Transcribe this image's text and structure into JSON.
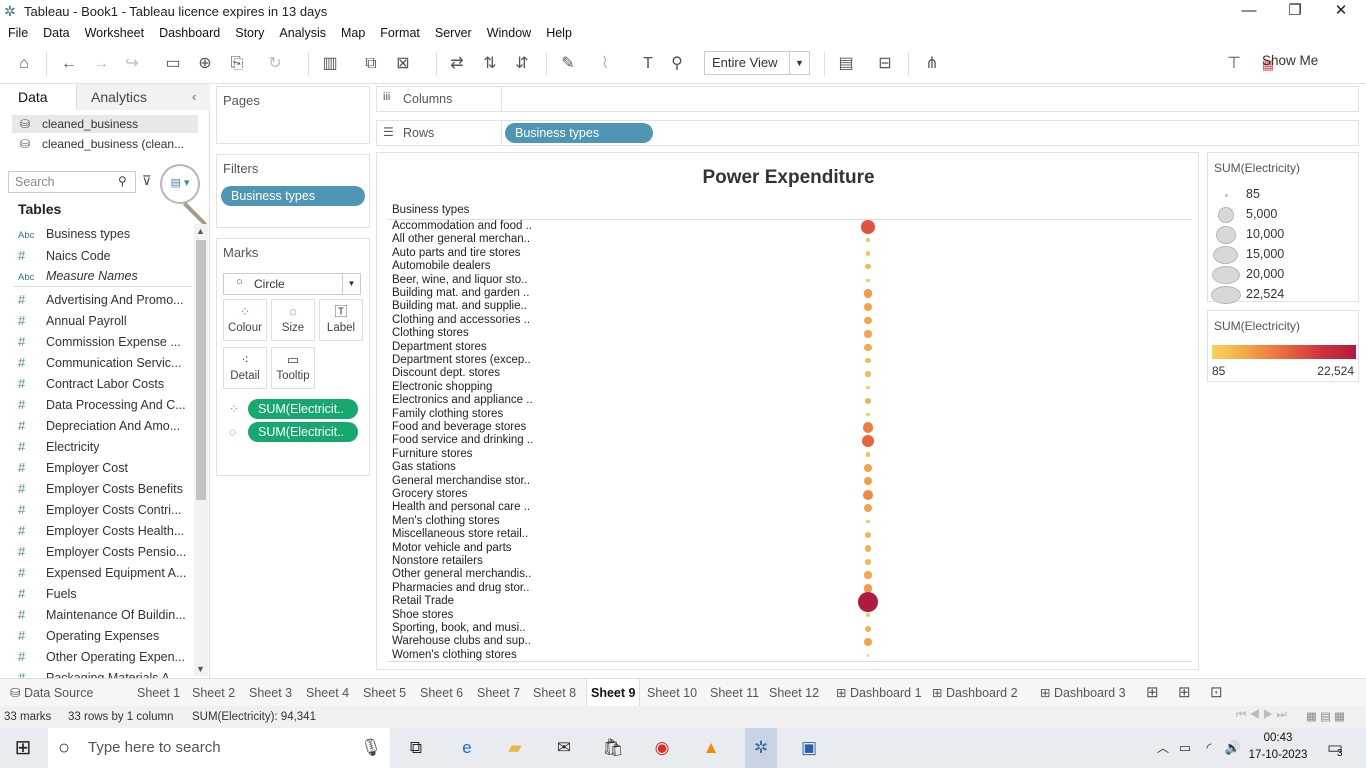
{
  "window": {
    "title": "Tableau - Book1 - Tableau licence expires in 13 days"
  },
  "menu": [
    "File",
    "Data",
    "Worksheet",
    "Dashboard",
    "Story",
    "Analysis",
    "Map",
    "Format",
    "Server",
    "Window",
    "Help"
  ],
  "toolbar": {
    "view_select": "Entire View",
    "show_me": "Show Me"
  },
  "left_pane": {
    "tab_data": "Data",
    "tab_analytics": "Analytics",
    "datasources": [
      "cleaned_business",
      "cleaned_business (clean..."
    ],
    "search_placeholder": "Search",
    "tables_label": "Tables",
    "fields": [
      {
        "type": "Abc",
        "name": "Business types"
      },
      {
        "type": "#",
        "name": "Naics Code"
      },
      {
        "type": "Abc",
        "name": "Measure Names"
      },
      {
        "type": "#",
        "name": "Advertising And Promo..."
      },
      {
        "type": "#",
        "name": "Annual Payroll"
      },
      {
        "type": "#",
        "name": "Commission Expense ..."
      },
      {
        "type": "#",
        "name": "Communication Servic..."
      },
      {
        "type": "#",
        "name": "Contract Labor Costs"
      },
      {
        "type": "#",
        "name": "Data Processing And C..."
      },
      {
        "type": "#",
        "name": "Depreciation And Amo..."
      },
      {
        "type": "#",
        "name": "Electricity"
      },
      {
        "type": "#",
        "name": "Employer Cost"
      },
      {
        "type": "#",
        "name": "Employer Costs Benefits"
      },
      {
        "type": "#",
        "name": "Employer Costs Contri..."
      },
      {
        "type": "#",
        "name": "Employer Costs Health..."
      },
      {
        "type": "#",
        "name": "Employer Costs Pensio..."
      },
      {
        "type": "#",
        "name": "Expensed Equipment A..."
      },
      {
        "type": "#",
        "name": "Fuels"
      },
      {
        "type": "#",
        "name": "Maintenance Of Buildin..."
      },
      {
        "type": "#",
        "name": "Operating Expenses"
      },
      {
        "type": "#",
        "name": "Other Operating Expen..."
      },
      {
        "type": "#",
        "name": "Packaging Materials A..."
      }
    ]
  },
  "pages": {
    "title": "Pages"
  },
  "filters": {
    "title": "Filters",
    "pill": "Business types"
  },
  "marks": {
    "title": "Marks",
    "type": "Circle",
    "buttons": [
      "Colour",
      "Size",
      "Label",
      "Detail",
      "Tooltip"
    ],
    "pills": [
      "SUM(Electricit..",
      "SUM(Electricit.."
    ]
  },
  "shelves": {
    "columns_label": "Columns",
    "rows_label": "Rows",
    "rows_pill": "Business types"
  },
  "size_legend": {
    "title": "SUM(Electricity)",
    "entries": [
      "85",
      "5,000",
      "10,000",
      "15,000",
      "20,000",
      "22,524"
    ]
  },
  "color_legend": {
    "title": "SUM(Electricity)",
    "min": "85",
    "max": "22,524",
    "colors": [
      "#f6d35e",
      "#f4a447",
      "#ea6a3c",
      "#d2333c",
      "#b01a3f"
    ]
  },
  "chart_data": {
    "type": "scatter",
    "title": "Power Expenditure",
    "row_header": "Business types",
    "categories": [
      "Accommodation and food ..",
      "All other general merchan..",
      "Auto parts and tire stores",
      "Automobile dealers",
      "Beer, wine, and liquor sto..",
      "Building mat. and garden ..",
      "Building mat. and supplie..",
      "Clothing and accessories ..",
      "Clothing stores",
      "Department stores",
      "Department stores (excep..",
      "Discount dept. stores",
      "Electronic shopping",
      "Electronics and appliance ..",
      "Family clothing stores",
      "Food and beverage stores",
      "Food service and drinking ..",
      "Furniture stores",
      "Gas stations",
      "General merchandise stor..",
      "Grocery stores",
      "Health and personal care ..",
      "Men's clothing stores",
      "Miscellaneous store retail..",
      "Motor vehicle and parts",
      "Nonstore retailers",
      "Other general merchandis..",
      "Pharmacies and drug stor..",
      "Retail Trade",
      "Shoe stores",
      "Sporting, book, and  musi..",
      "Warehouse clubs and sup..",
      "Women's clothing stores"
    ],
    "values": [
      9800,
      300,
      500,
      800,
      200,
      3000,
      2400,
      2100,
      2000,
      1900,
      800,
      900,
      300,
      1200,
      200,
      5400,
      7800,
      600,
      2200,
      2800,
      4400,
      2600,
      200,
      1200,
      1500,
      1000,
      2000,
      2700,
      22524,
      400,
      1400,
      2600,
      100
    ],
    "size_range": [
      85,
      22524
    ],
    "color_range": [
      85,
      22524
    ]
  },
  "sheet_tabs": {
    "datasource": "Data Source",
    "tabs": [
      "Sheet 1",
      "Sheet 2",
      "Sheet 3",
      "Sheet 4",
      "Sheet 5",
      "Sheet 6",
      "Sheet 7",
      "Sheet 8",
      "Sheet 9",
      "Sheet 10",
      "Sheet 11",
      "Sheet 12",
      "Dashboard 1",
      "Dashboard 2",
      "Dashboard 3"
    ],
    "active": "Sheet 9"
  },
  "status": {
    "marks": "33 marks",
    "rows": "33 rows by 1 column",
    "sum": "SUM(Electricity): 94,341"
  },
  "taskbar": {
    "search_placeholder": "Type here to search",
    "time": "00:43",
    "date": "17-10-2023",
    "notifications": "3"
  }
}
